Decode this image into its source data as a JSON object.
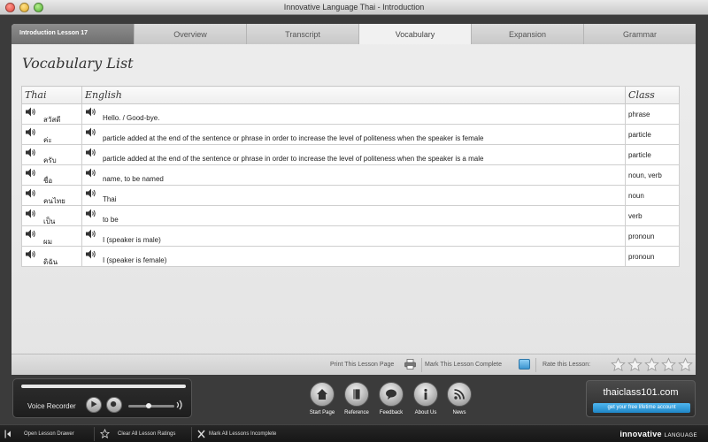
{
  "window": {
    "title": "Innovative Language Thai - Introduction"
  },
  "tabs": {
    "lesson_label": "Introduction Lesson 17",
    "items": [
      "Overview",
      "Transcript",
      "Vocabulary",
      "Expansion",
      "Grammar"
    ],
    "active": "Vocabulary"
  },
  "page": {
    "heading": "Vocabulary List"
  },
  "table": {
    "headers": {
      "thai": "Thai",
      "english": "English",
      "class": "Class"
    },
    "rows": [
      {
        "thai": "สวัสดี",
        "english": "Hello. / Good-bye.",
        "class": "phrase"
      },
      {
        "thai": "ค่ะ",
        "english": "particle added at the end of the sentence or phrase in order to increase the level of politeness when the speaker is female",
        "class": "particle"
      },
      {
        "thai": "ครับ",
        "english": "particle added at the end of the sentence or phrase in order to increase the level of politeness when the speaker is a male",
        "class": "particle"
      },
      {
        "thai": "ชื่อ",
        "english": "name, to be named",
        "class": "noun, verb"
      },
      {
        "thai": "คนไทย",
        "english": "Thai",
        "class": "noun"
      },
      {
        "thai": "เป็น",
        "english": "to be",
        "class": "verb"
      },
      {
        "thai": "ผม",
        "english": "I (speaker is male)",
        "class": "pronoun"
      },
      {
        "thai": "ดิฉัน",
        "english": "I (speaker is female)",
        "class": "pronoun"
      }
    ]
  },
  "lesson_footer": {
    "print_label": "Print This Lesson Page",
    "complete_label": "Mark This Lesson Complete",
    "rate_label": "Rate this Lesson:",
    "rating": 0,
    "rating_max": 5
  },
  "voice_recorder": {
    "label": "Voice Recorder",
    "volume": 0.45
  },
  "nav": [
    {
      "label": "Start Page",
      "icon": "home-icon"
    },
    {
      "label": "Reference",
      "icon": "book-icon"
    },
    {
      "label": "Feedback",
      "icon": "speech-bubble-icon"
    },
    {
      "label": "About Us",
      "icon": "info-icon"
    },
    {
      "label": "News",
      "icon": "rss-icon"
    }
  ],
  "brand": {
    "site": "thaiclass101.com",
    "cta": "get your free lifetime account"
  },
  "statusbar": {
    "open_drawer": "Open Lesson Drawer",
    "clear_ratings": "Clear All Lesson Ratings",
    "mark_incomplete": "Mark All Lessons Incomplete",
    "logo_main": "innovative",
    "logo_sub": "LANGUAGE"
  },
  "colors": {
    "accent": "#2f8fd0",
    "panel": "#ececec",
    "dark": "#2a2a2a"
  }
}
